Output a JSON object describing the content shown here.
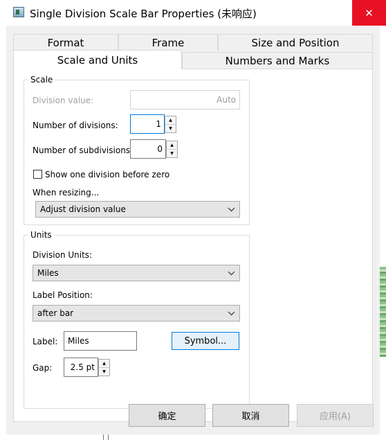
{
  "window": {
    "title": "Single Division Scale Bar Properties (未响应)",
    "close_glyph": "✕"
  },
  "tabs": {
    "format": "Format",
    "frame": "Frame",
    "size_position": "Size and Position",
    "scale_units": "Scale and Units",
    "numbers_marks": "Numbers and Marks"
  },
  "scale": {
    "group_label": "Scale",
    "division_value_label": "Division value:",
    "division_value": "Auto",
    "num_divisions_label": "Number of divisions:",
    "num_divisions": "1",
    "num_subdivisions_label": "Number of subdivisions:",
    "num_subdivisions": "0",
    "show_one_division_label": "Show one division before zero",
    "show_one_division_checked": false,
    "when_resizing_label": "When resizing...",
    "when_resizing_value": "Adjust division value"
  },
  "units": {
    "group_label": "Units",
    "division_units_label": "Division Units:",
    "division_units_value": "Miles",
    "label_position_label": "Label Position:",
    "label_position_value": "after bar",
    "label_label": "Label:",
    "label_value": "Miles",
    "symbol_button": "Symbol...",
    "gap_label": "Gap:",
    "gap_value": "2.5 pt"
  },
  "buttons": {
    "ok": "确定",
    "cancel": "取消",
    "apply": "应用(A)"
  },
  "icons": {
    "spin_up": "▲",
    "spin_down": "▼",
    "chevron": "⌄"
  }
}
